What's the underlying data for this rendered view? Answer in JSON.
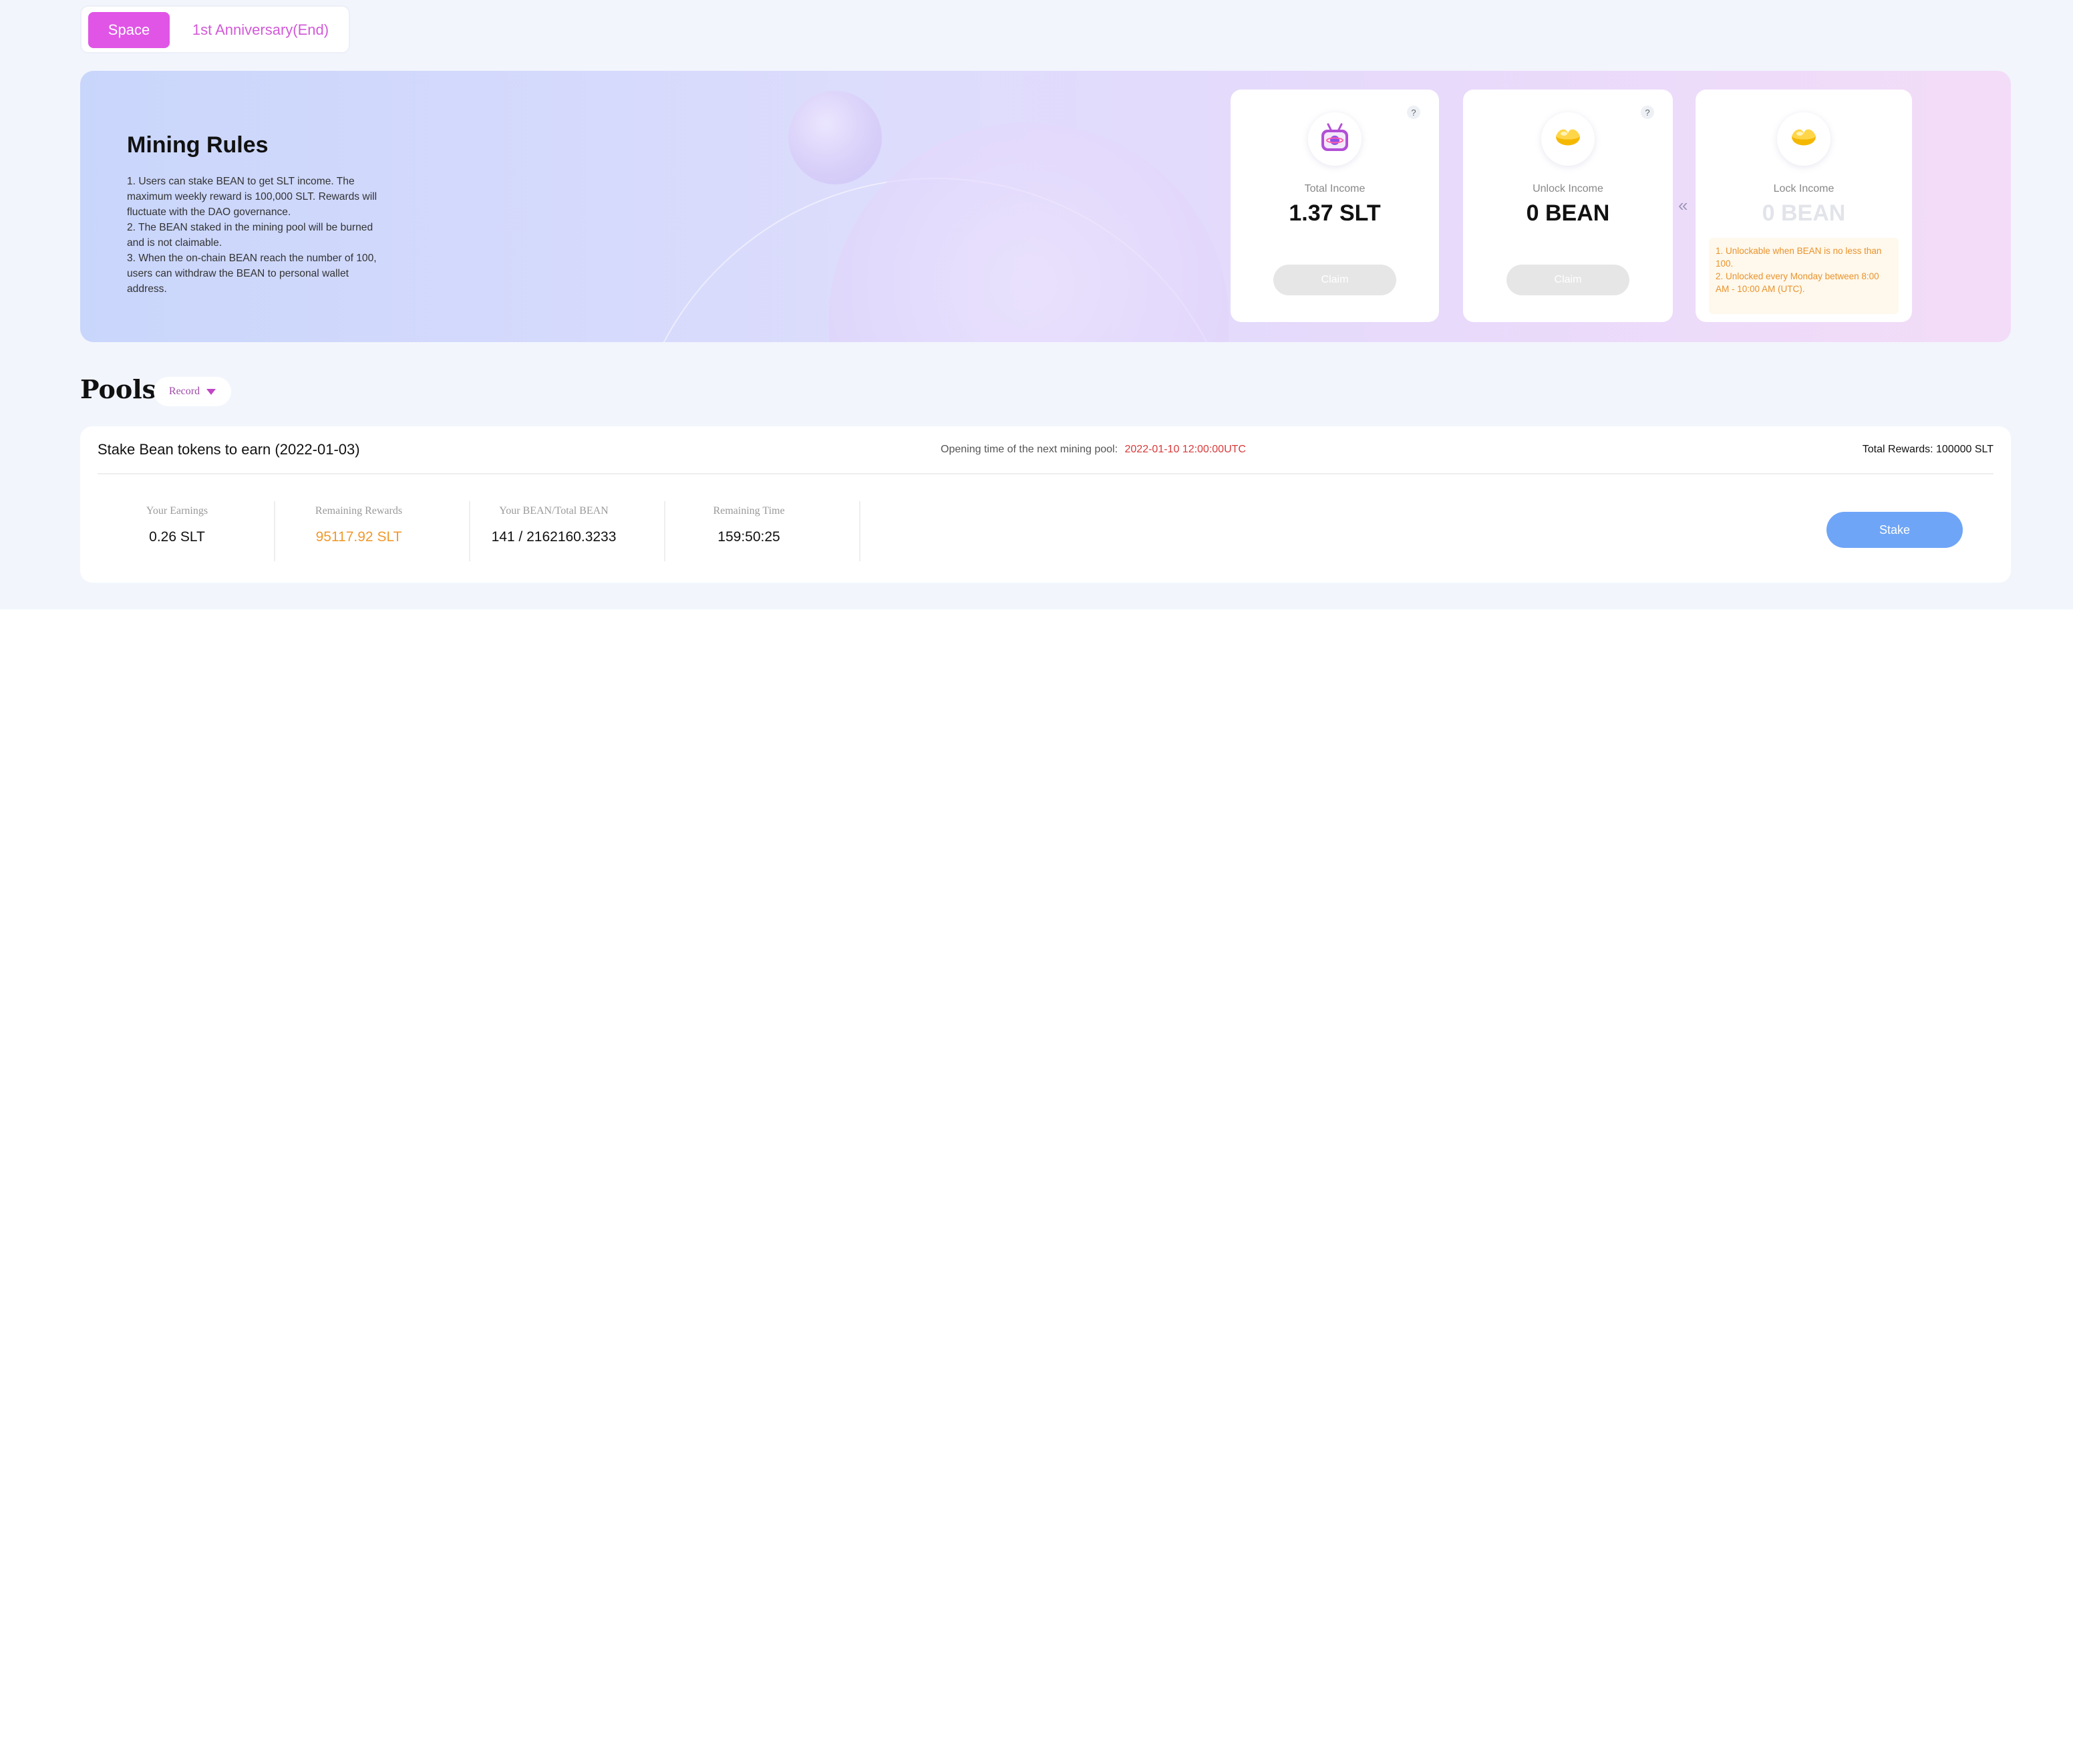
{
  "tabs": [
    {
      "label": "Space",
      "active": true
    },
    {
      "label": "1st Anniversary(End)",
      "active": false
    }
  ],
  "mining_rules": {
    "title": "Mining Rules",
    "lines": [
      "1. Users can stake BEAN to get SLT income. The maximum weekly reward is 100,000 SLT. Rewards will fluctuate with the DAO governance.",
      "2. The BEAN staked in the mining pool will be burned and is not claimable.",
      "3. When the on-chain BEAN reach the number of 100, users can withdraw the BEAN to personal wallet address."
    ]
  },
  "income_cards": {
    "total": {
      "label": "Total Income",
      "value": "1.37 SLT",
      "button": "Claim",
      "help": "?",
      "icon": "planet-tv-icon"
    },
    "unlock": {
      "label": "Unlock Income",
      "value": "0 BEAN",
      "button": "Claim",
      "help": "?",
      "icon": "bean-icon"
    },
    "lock": {
      "label": "Lock Income",
      "value": "0 BEAN",
      "icon": "bean-icon",
      "notes": [
        "1. Unlockable when BEAN is no less than 100.",
        "2. Unlocked every Monday between 8:00 AM - 10:00 AM (UTC)."
      ]
    },
    "arrow": "«"
  },
  "pools": {
    "title": "Pools",
    "record_label": "Record",
    "pool": {
      "name": "Stake Bean tokens to earn (2022-01-03)",
      "opening_label": "Opening time of the next mining pool:",
      "opening_time": "2022-01-10 12:00:00UTC",
      "total_rewards_label": "Total Rewards:",
      "total_rewards_value": "100000 SLT",
      "stats": [
        {
          "label": "Your Earnings",
          "value": "0.26 SLT"
        },
        {
          "label": "Remaining Rewards",
          "value": "95117.92 SLT"
        },
        {
          "label": "Your BEAN/Total BEAN",
          "value": "141 / 2162160.3233"
        },
        {
          "label": "Remaining Time",
          "value": "159:50:25"
        }
      ],
      "stake_label": "Stake"
    }
  },
  "colors": {
    "accent": "#e055e6",
    "stake_button": "#6ea5f7",
    "opening_time": "#d8393a",
    "remaining_rewards": "#f0992c",
    "lock_note": "#e8932c"
  }
}
